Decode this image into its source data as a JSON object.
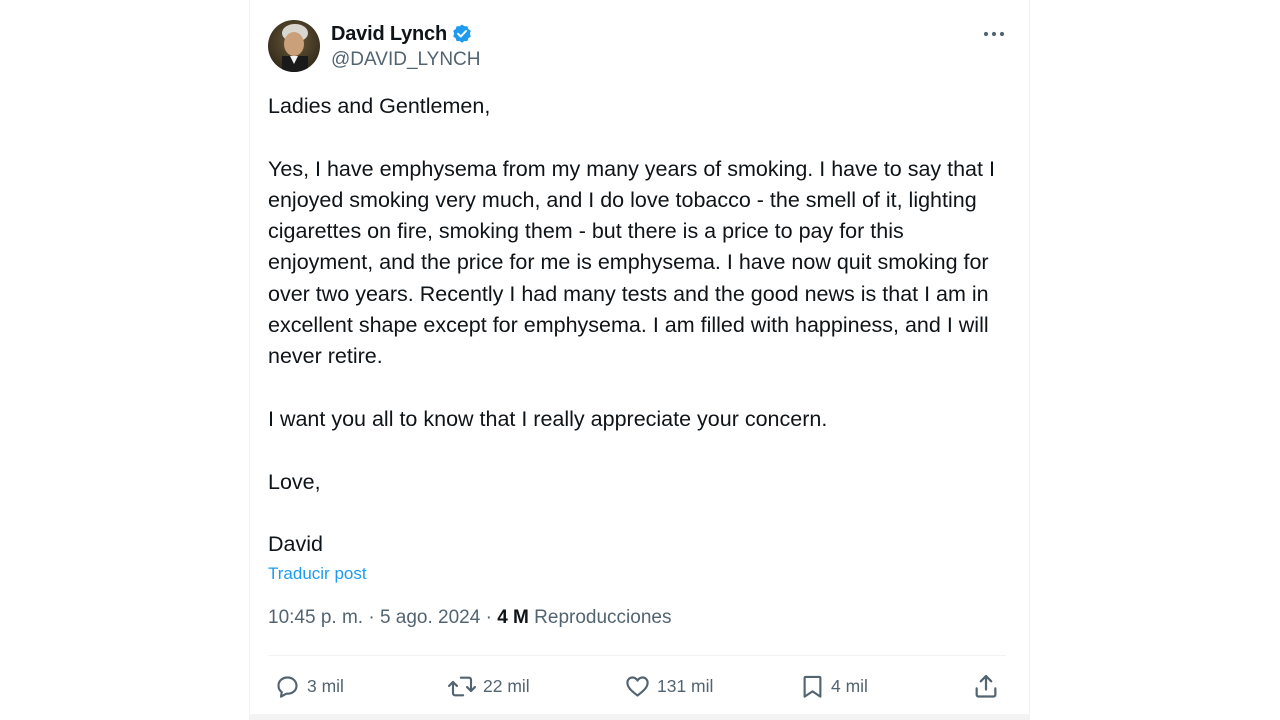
{
  "author": {
    "display_name": "David Lynch",
    "handle": "@DAVID_LYNCH",
    "verified": true
  },
  "tweet": {
    "paragraphs": [
      "Ladies and Gentlemen,",
      "Yes, I have emphysema from my many years of smoking. I have to say that I enjoyed smoking very much, and I do love tobacco - the smell of it, lighting cigarettes on fire, smoking them - but there is a price to pay for this enjoyment, and the price for me is emphysema. I have now quit smoking for over two years. Recently I had many tests and the good news is that I am in excellent shape except for emphysema. I am filled with happiness, and I will never retire.",
      "I want you all to know that I really appreciate your concern.",
      "Love,",
      "David"
    ],
    "translate_label": "Traducir post",
    "timestamp": "10:45 p. m. · 5 ago. 2024 · ",
    "views_count": "4 M",
    "views_label": " Reproducciones"
  },
  "actions": {
    "replies": "3 mil",
    "reposts": "22 mil",
    "likes": "131 mil",
    "bookmarks": "4 mil"
  },
  "icons": {
    "verified": "verified-badge-icon",
    "more": "more-dots-icon",
    "reply": "reply-icon",
    "repost": "repost-icon",
    "like": "heart-icon",
    "bookmark": "bookmark-icon",
    "share": "share-icon"
  },
  "colors": {
    "link_blue": "#1d9bf0",
    "text_primary": "#0f1419",
    "text_secondary": "#536471",
    "divider": "#eff3f4"
  }
}
